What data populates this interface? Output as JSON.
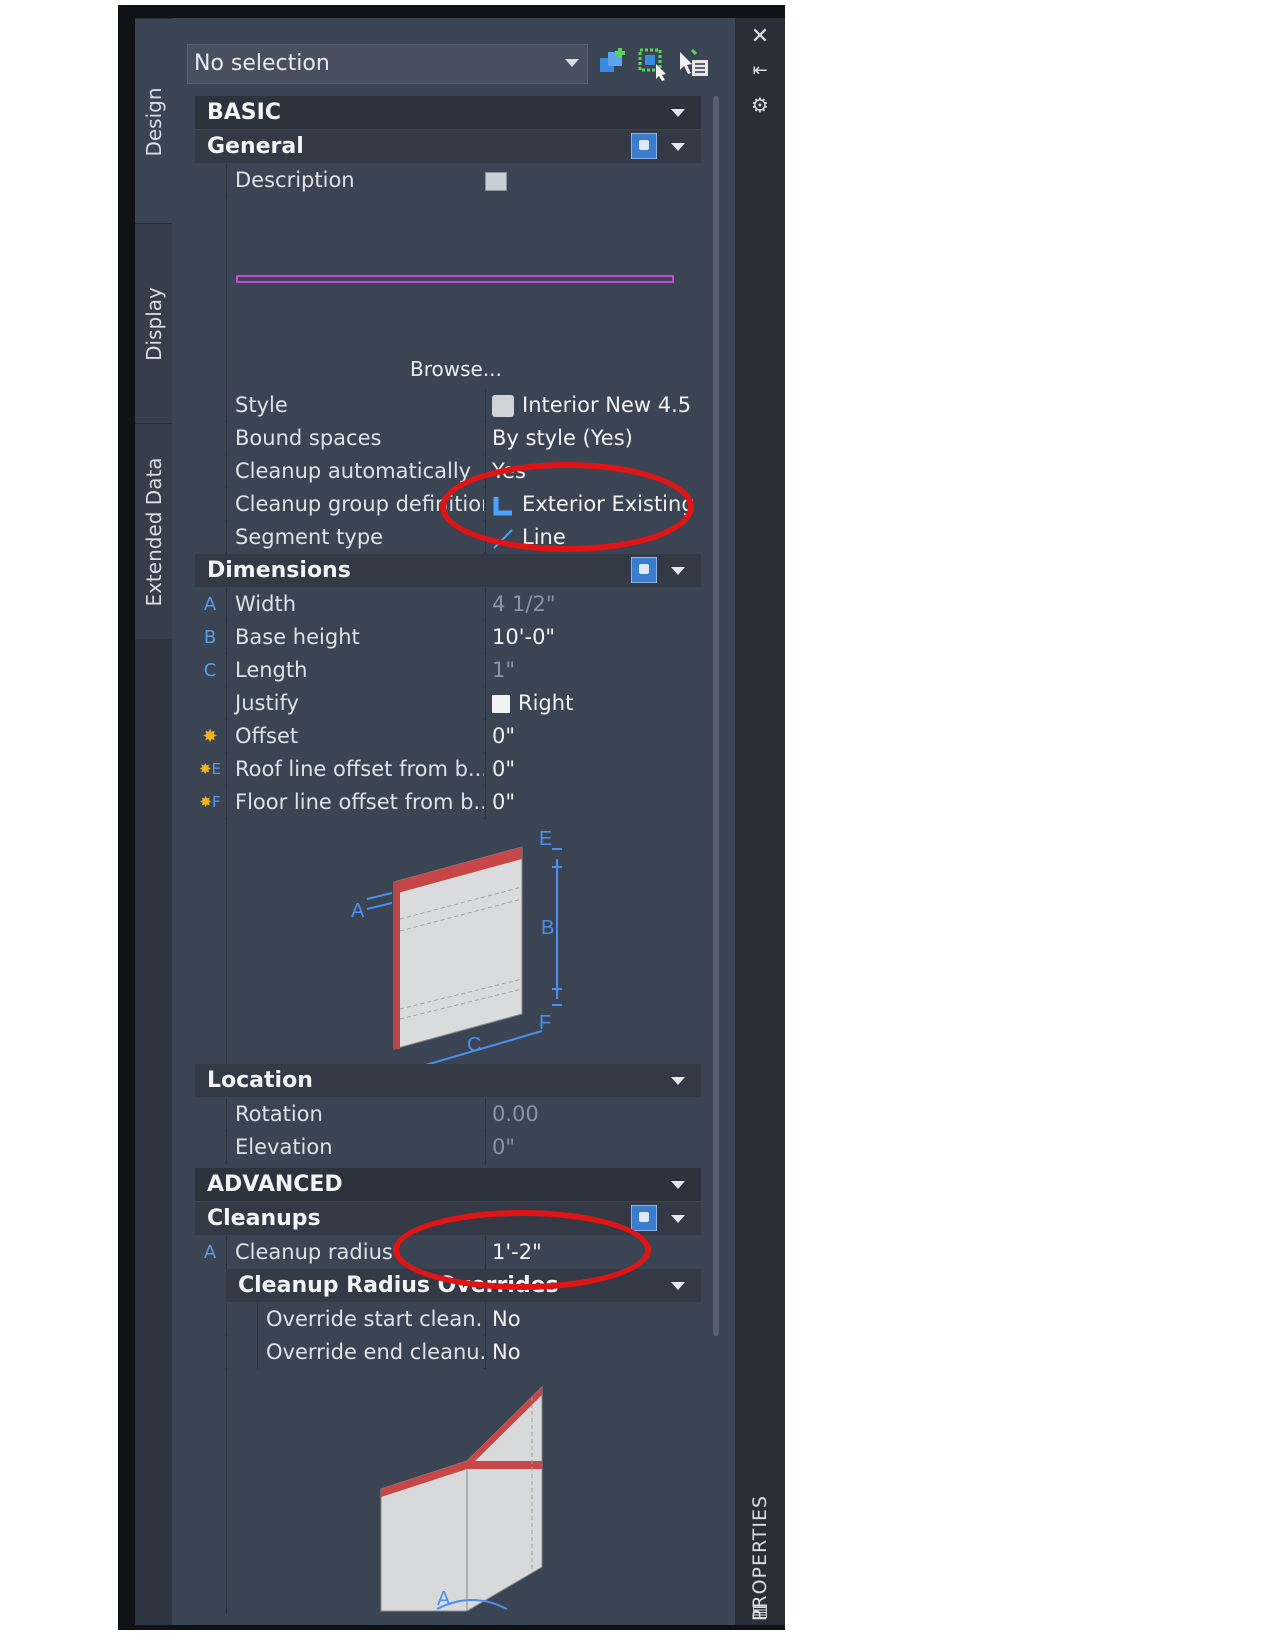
{
  "palette": {
    "selection": "No selection",
    "side_tabs": [
      "Design",
      "Display",
      "Extended Data"
    ],
    "strip_label": "PROPERTIES",
    "icons": {
      "close": "close-icon",
      "auto_hide": "auto-hide-icon",
      "settings": "settings-icon",
      "add_selection": "add-to-selection-icon",
      "quick_select": "quick-select-icon",
      "select_objects": "select-objects-icon",
      "properties_bottom": "properties-panel-icon"
    },
    "colors": {
      "background": "#3b4453",
      "header": "#2d333d",
      "accent": "#5b9be6",
      "highlight": "#e01414"
    }
  },
  "basic": {
    "title": "BASIC",
    "general": {
      "title": "General",
      "description_label": "Description",
      "browse_label": "Browse...",
      "rows": [
        {
          "label": "Style",
          "value": "Interior New 4.5",
          "icon": "style-icon"
        },
        {
          "label": "Bound spaces",
          "value": "By style (Yes)"
        },
        {
          "label": "Cleanup automatically",
          "value": "Yes"
        },
        {
          "label": "Cleanup group definition",
          "value": "Exterior Existing",
          "icon": "cleanup-group-icon"
        },
        {
          "label": "Segment type",
          "value": "Line",
          "icon": "line-segment-icon"
        }
      ]
    },
    "dimensions": {
      "title": "Dimensions",
      "rows": [
        {
          "key": "A",
          "label": "Width",
          "value": "4 1/2\""
        },
        {
          "key": "B",
          "label": "Base height",
          "value": "10'-0\""
        },
        {
          "key": "C",
          "label": "Length",
          "value": "1\""
        },
        {
          "key": "",
          "label": "Justify",
          "value": "Right",
          "icon": "justify-icon"
        },
        {
          "key": "",
          "label": "Offset",
          "value": "0\"",
          "icon": "offset-icon"
        },
        {
          "key": "E",
          "label": "Roof line offset from b...",
          "value": "0\"",
          "icon": "offset-icon"
        },
        {
          "key": "F",
          "label": "Floor line offset from b...",
          "value": "0\"",
          "icon": "offset-icon"
        }
      ],
      "diagram_labels": [
        "A",
        "B",
        "C",
        "E",
        "F"
      ]
    },
    "location": {
      "title": "Location",
      "rows": [
        {
          "label": "Rotation",
          "value": "0.00"
        },
        {
          "label": "Elevation",
          "value": "0\""
        }
      ]
    }
  },
  "advanced": {
    "title": "ADVANCED",
    "cleanups": {
      "title": "Cleanups",
      "rows": [
        {
          "key": "A",
          "label": "Cleanup radius",
          "value": "1'-2\""
        }
      ],
      "override_title": "Cleanup Radius Overrides",
      "override_rows": [
        {
          "label": "Override start clean...",
          "value": "No"
        },
        {
          "label": "Override end cleanu...",
          "value": "No"
        }
      ],
      "diagram_labels": [
        "A"
      ]
    }
  }
}
